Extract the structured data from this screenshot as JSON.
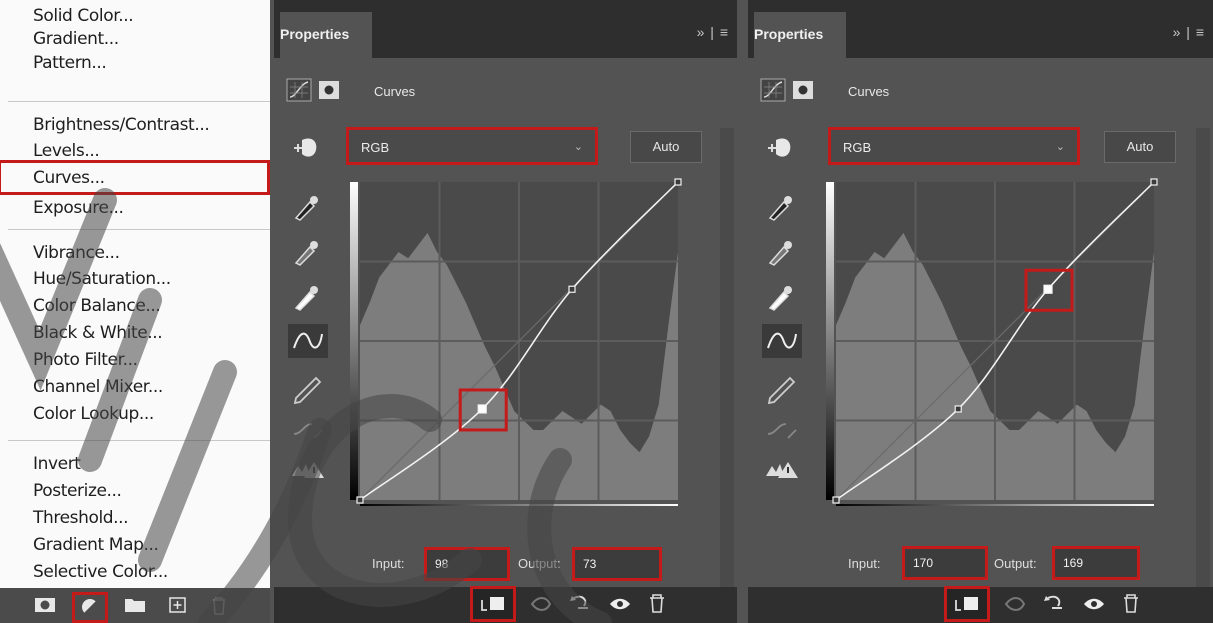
{
  "menu": {
    "group1": [
      "Solid Color...",
      "Gradient...",
      "Pattern..."
    ],
    "group2": [
      "Brightness/Contrast...",
      "Levels...",
      "Curves...",
      "Exposure..."
    ],
    "group3": [
      "Vibrance...",
      "Hue/Saturation...",
      "Color Balance...",
      "Black & White...",
      "Photo Filter...",
      "Channel Mixer...",
      "Color Lookup..."
    ],
    "group4": [
      "Invert",
      "Posterize...",
      "Threshold...",
      "Gradient Map...",
      "Selective Color..."
    ],
    "selected": "Curves..."
  },
  "panel_left": {
    "tab_title": "Properties",
    "tab_controls": "»  |  ≡",
    "adjustment_name": "Curves",
    "channel": "RGB",
    "auto_label": "Auto",
    "input_label": "Input:",
    "input_value": "98",
    "output_label": "Output:",
    "output_value": "73"
  },
  "panel_right": {
    "tab_title": "Properties",
    "tab_controls": "»  |  ≡",
    "adjustment_name": "Curves",
    "channel": "RGB",
    "auto_label": "Auto",
    "input_label": "Input:",
    "input_value": "170",
    "output_label": "Output:",
    "output_value": "169"
  },
  "colors": {
    "highlight_red": "#c41a1a",
    "panel_bg": "#535353",
    "menu_bg": "#fafafa"
  },
  "icons": [
    "black-point-eyedropper-icon",
    "gray-point-eyedropper-icon",
    "white-point-eyedropper-icon",
    "curve-point-tool-icon",
    "pencil-icon",
    "smooth-icon",
    "clipping-warning-icon",
    "clip-to-layer-icon",
    "view-previous-icon",
    "reset-icon",
    "visibility-icon",
    "trash-icon"
  ]
}
